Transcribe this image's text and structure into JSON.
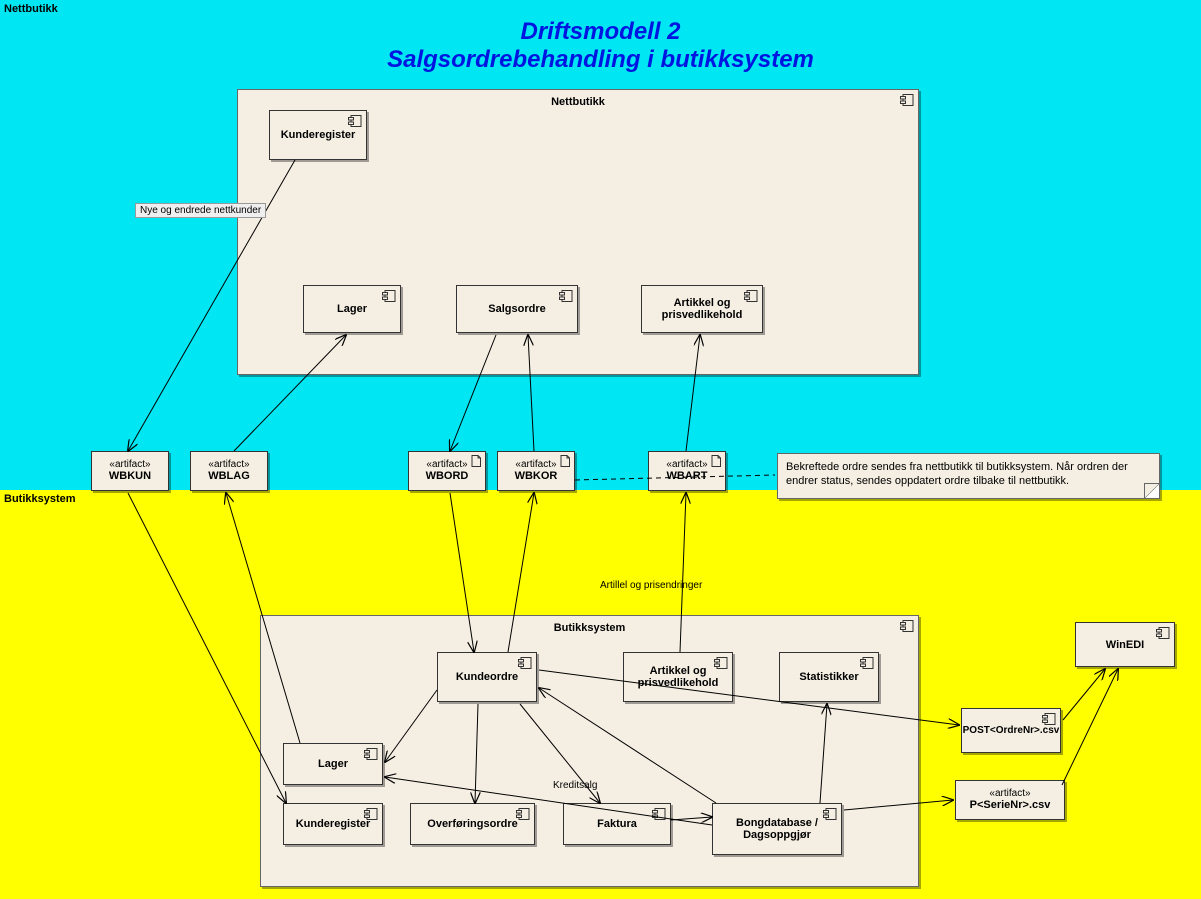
{
  "title_line1": "Driftsmodell 2",
  "title_line2": "Salgsordrebehandling i butikksystem",
  "swimlanes": {
    "top_label": "Nettbutikk",
    "bottom_label": "Butikksystem"
  },
  "containers": {
    "nettbutikk": {
      "label": "Nettbutikk"
    },
    "butikksystem": {
      "label": "Butikksystem"
    }
  },
  "components": {
    "nb_kunderegister": "Kunderegister",
    "nb_lager": "Lager",
    "nb_salgsordre": "Salgsordre",
    "nb_artikkel": "Artikkel og prisvedlikehold",
    "bs_kundeordre": "Kundeordre",
    "bs_artikkel": "Artikkel og prisvedlikehold",
    "bs_statistikker": "Statistikker",
    "bs_lager": "Lager",
    "bs_kunderegister": "Kunderegister",
    "bs_overforing": "Overføringsordre",
    "bs_faktura": "Faktura",
    "bs_bong": "Bongdatabase / Dagsoppgjør",
    "winedi": "WinEDI",
    "postordre": "POST<OrdreNr>.csv"
  },
  "artifacts": {
    "stereotype": "«artifact»",
    "wbkun": "WBKUN",
    "wblag": "WBLAG",
    "wbord": "WBORD",
    "wbkor": "WBKOR",
    "wbart": "WBART",
    "pserie": "P<SerieNr>.csv"
  },
  "note": {
    "text": "Bekreftede ordre sendes fra nettbutikk til butikksystem. Når ordren der endrer status, sendes oppdatert ordre tilbake til nettbutikk."
  },
  "edge_labels": {
    "nye_kunder": "Nye og endrede nettkunder",
    "artikkel_pris": "Artillel og prisendringer",
    "kreditsalg": "Kreditsalg"
  }
}
